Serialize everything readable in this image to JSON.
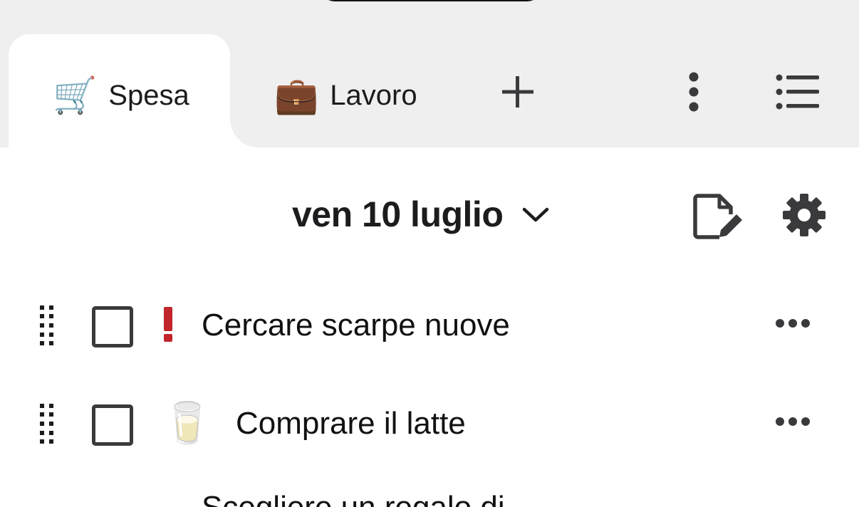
{
  "tabs": [
    {
      "emoji": "🛒",
      "label": "Spesa",
      "active": true
    },
    {
      "emoji": "💼",
      "label": "Lavoro",
      "active": false
    }
  ],
  "tabbar_icons": {
    "add": "plus-icon",
    "more": "more-vertical-icon",
    "lists": "list-icon"
  },
  "header": {
    "date": "ven 10 luglio",
    "date_dropdown_icon": "chevron-down-icon",
    "edit_icon": "edit-note-icon",
    "settings_icon": "gear-icon"
  },
  "items": [
    {
      "text": "Cercare scarpe nuove",
      "priority": "!",
      "emoji": "",
      "checked": false
    },
    {
      "text": "Comprare il latte",
      "priority": "",
      "emoji": "🥛",
      "checked": false
    }
  ],
  "partial_item": {
    "text": "Scegliere un regalo di"
  },
  "colors": {
    "tabbar_bg": "#efefef",
    "priority_red": "#c0262b",
    "icon_dark": "#3a3a3c"
  }
}
